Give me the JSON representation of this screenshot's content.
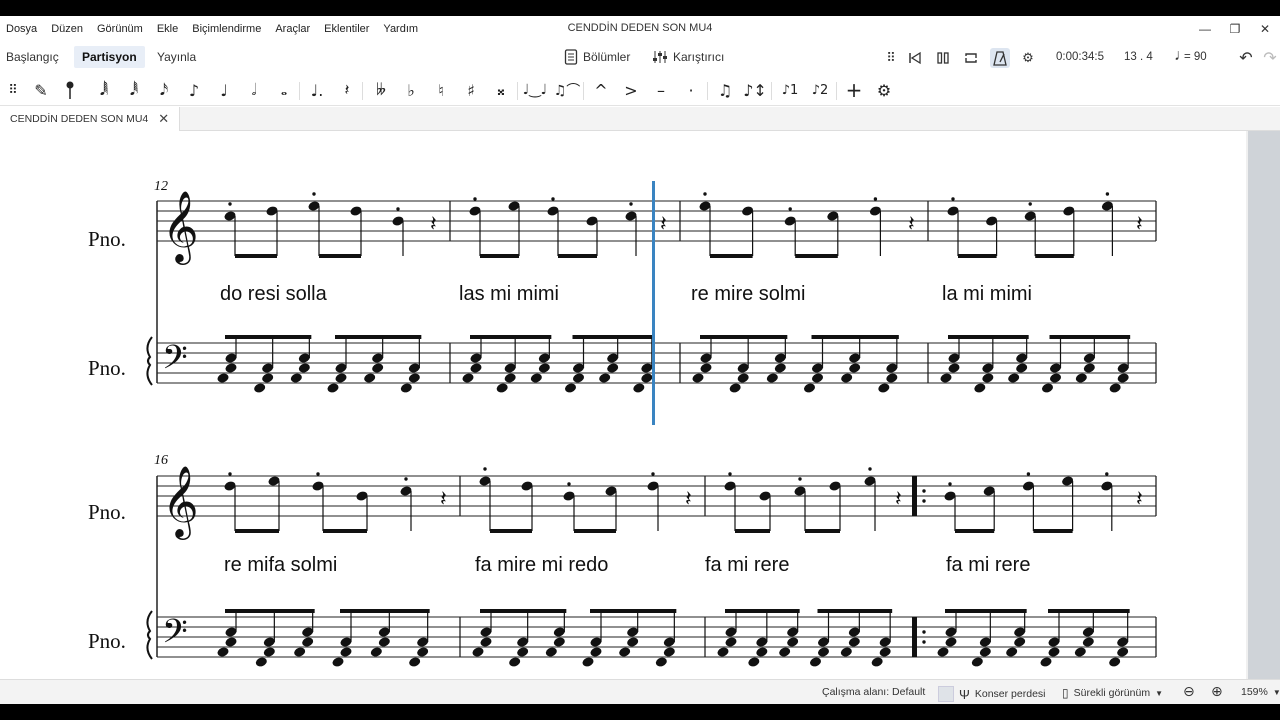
{
  "window": {
    "title": "CENDDİN DEDEN SON MU4",
    "controls": [
      "—",
      "❐",
      "✕"
    ]
  },
  "menu": [
    "Dosya",
    "Düzen",
    "Görünüm",
    "Ekle",
    "Biçimlendirme",
    "Araçlar",
    "Eklentiler",
    "Yardım"
  ],
  "tabs": [
    {
      "label": "Başlangıç"
    },
    {
      "label": "Partisyon"
    },
    {
      "label": "Yayınla"
    }
  ],
  "center_buttons": {
    "parts_label": "Bölümler",
    "mixer_label": "Karıştırıcı"
  },
  "playback": {
    "time": "0:00:34:5",
    "position": "13 . 4",
    "tempo": "= 90"
  },
  "document_tab": {
    "label": "CENDDİN DEDEN SON MU4",
    "close": "✕"
  },
  "score": {
    "instrument_short": "Pno.",
    "system1_measure": "12",
    "system2_measure": "16",
    "lyrics_system1": [
      "do resi solla",
      "las mi mimi",
      "re mire solmi",
      "la  mi mimi"
    ],
    "lyrics_system2": [
      "re mifa solmi",
      "fa mire  mi redo",
      "fa  mi rere",
      "fa  mi rere"
    ]
  },
  "status": {
    "workspace": "Çalışma alanı: Default",
    "concert_pitch": "Konser perdesi",
    "view_mode": "Sürekli görünüm",
    "zoom": "159%"
  }
}
